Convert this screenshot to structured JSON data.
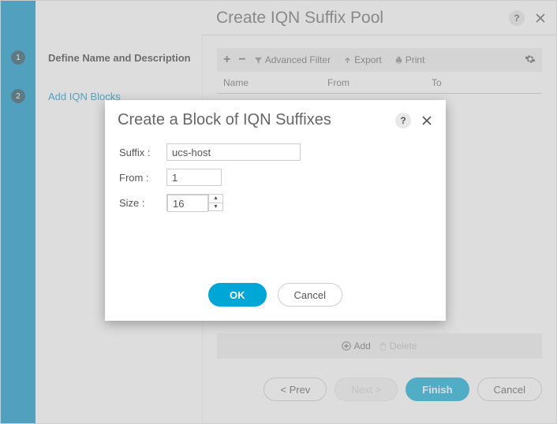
{
  "wizard": {
    "title": "Create IQN Suffix Pool",
    "steps": [
      {
        "num": "1",
        "label": "Define Name and Description"
      },
      {
        "num": "2",
        "label": "Add IQN Blocks"
      }
    ],
    "buttons": {
      "prev": "< Prev",
      "next": "Next >",
      "finish": "Finish",
      "cancel": "Cancel"
    }
  },
  "toolbar": {
    "adv_filter": "Advanced Filter",
    "export": "Export",
    "print": "Print"
  },
  "table": {
    "cols": {
      "name": "Name",
      "from": "From",
      "to": "To"
    }
  },
  "add_del": {
    "add": "Add",
    "delete": "Delete"
  },
  "dialog": {
    "title": "Create a Block of IQN Suffixes",
    "fields": {
      "suffix_label": "Suffix :",
      "suffix_value": "ucs-host",
      "from_label": "From  :",
      "from_value": "1",
      "size_label": "Size   :",
      "size_value": "16"
    },
    "buttons": {
      "ok": "OK",
      "cancel": "Cancel"
    }
  }
}
